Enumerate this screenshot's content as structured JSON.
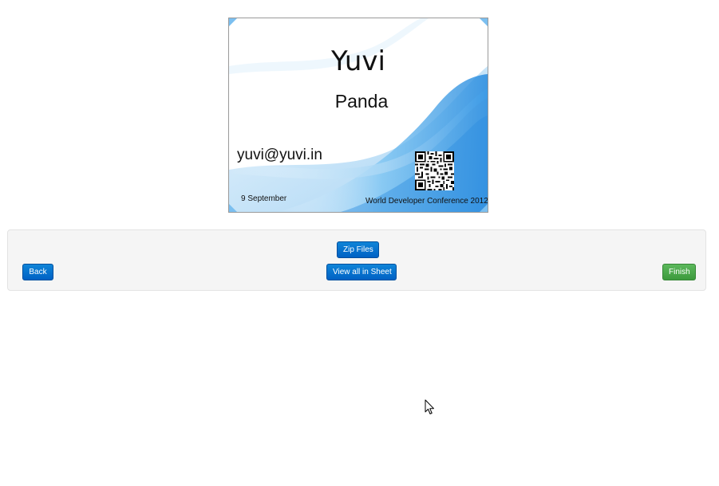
{
  "badge": {
    "first_name": "Yuvi",
    "last_name": "Panda",
    "email": "yuvi@yuvi.in",
    "date": "9 September",
    "event": "World Developer Conference 2012",
    "qr_icon": "qr-code-icon",
    "accent_color": "#3a9be6"
  },
  "actions": {
    "zip_label": "Zip Files",
    "view_sheet_label": "View all in Sheet",
    "back_label": "Back",
    "finish_label": "Finish",
    "primary_color": "#0074cc",
    "success_color": "#51a351"
  },
  "cursor_icon": "mouse-pointer-icon"
}
